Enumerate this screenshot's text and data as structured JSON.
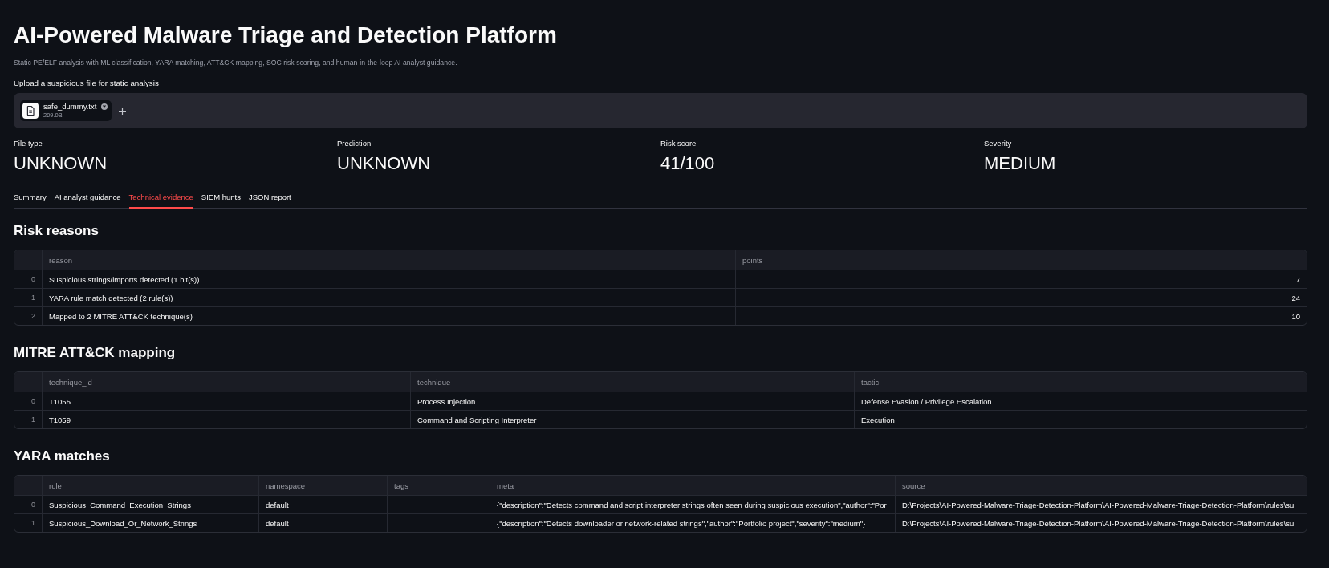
{
  "page": {
    "title": "AI-Powered Malware Triage and Detection Platform",
    "subtitle": "Static PE/ELF analysis with ML classification, YARA matching, ATT&CK mapping, SOC risk scoring, and human-in-the-loop AI analyst guidance."
  },
  "uploader": {
    "label": "Upload a suspicious file for static analysis",
    "files": [
      {
        "name": "safe_dummy.txt",
        "size": "209.0B"
      }
    ]
  },
  "metrics": [
    {
      "label": "File type",
      "value": "UNKNOWN"
    },
    {
      "label": "Prediction",
      "value": "UNKNOWN"
    },
    {
      "label": "Risk score",
      "value": "41/100"
    },
    {
      "label": "Severity",
      "value": "MEDIUM"
    }
  ],
  "tabs": [
    {
      "label": "Summary",
      "selected": false
    },
    {
      "label": "AI analyst guidance",
      "selected": false
    },
    {
      "label": "Technical evidence",
      "selected": true
    },
    {
      "label": "SIEM hunts",
      "selected": false
    },
    {
      "label": "JSON report",
      "selected": false
    }
  ],
  "sections": [
    {
      "heading": "Risk reasons",
      "table": {
        "columns": [
          "reason",
          "points"
        ],
        "rows": [
          {
            "index": "0",
            "cells": [
              "Suspicious strings/imports detected (1 hit(s))",
              "7"
            ]
          },
          {
            "index": "1",
            "cells": [
              "YARA rule match detected (2 rule(s))",
              "24"
            ]
          },
          {
            "index": "2",
            "cells": [
              "Mapped to 2 MITRE ATT&CK technique(s)",
              "10"
            ]
          }
        ]
      }
    },
    {
      "heading": "MITRE ATT&CK mapping",
      "table": {
        "columns": [
          "technique_id",
          "technique",
          "tactic"
        ],
        "rows": [
          {
            "index": "0",
            "cells": [
              "T1055",
              "Process Injection",
              "Defense Evasion / Privilege Escalation"
            ]
          },
          {
            "index": "1",
            "cells": [
              "T1059",
              "Command and Scripting Interpreter",
              "Execution"
            ]
          }
        ]
      }
    },
    {
      "heading": "YARA matches",
      "table": {
        "columns": [
          "rule",
          "namespace",
          "tags",
          "meta",
          "source"
        ],
        "rows": [
          {
            "index": "0",
            "cells": [
              "Suspicious_Command_Execution_Strings",
              "default",
              null,
              "{\"description\":\"Detects command and script interpreter strings often seen during suspicious execution\",\"author\":\"Por",
              "D:\\Projects\\AI-Powered-Malware-Triage-Detection-Platform\\AI-Powered-Malware-Triage-Detection-Platform\\rules\\su"
            ]
          },
          {
            "index": "1",
            "cells": [
              "Suspicious_Download_Or_Network_Strings",
              "default",
              null,
              "{\"description\":\"Detects downloader or network-related strings\",\"author\":\"Portfolio project\",\"severity\":\"medium\"}",
              "D:\\Projects\\AI-Powered-Malware-Triage-Detection-Platform\\AI-Powered-Malware-Triage-Detection-Platform\\rules\\su"
            ]
          }
        ]
      }
    }
  ]
}
